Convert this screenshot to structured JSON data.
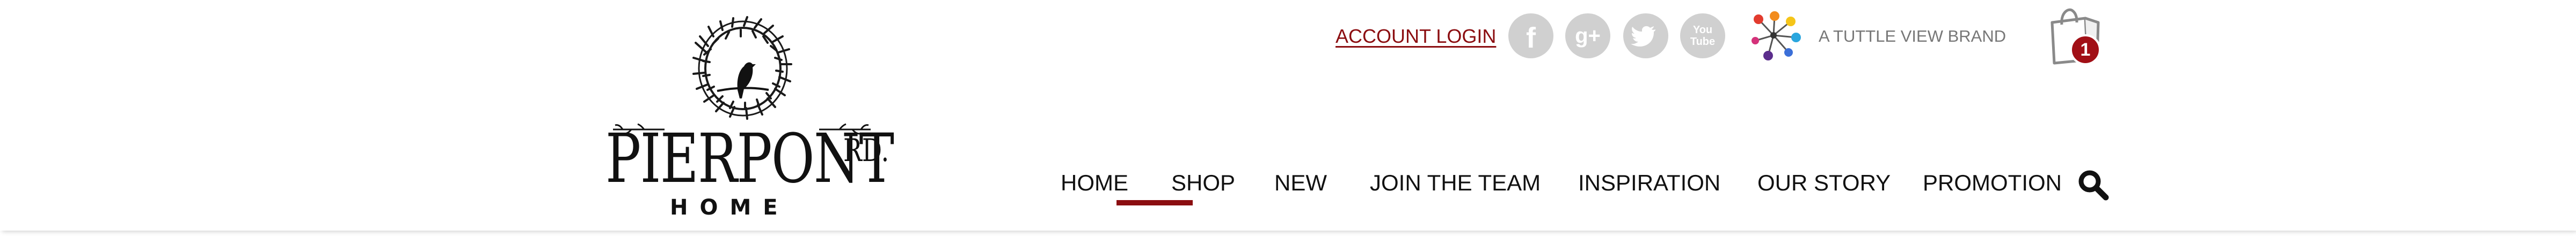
{
  "logo": {
    "main_text": "PIERPONT",
    "suffix_text": "RD.",
    "sub_text": "HOME"
  },
  "utility_bar": {
    "account_login": "ACCOUNT LOGIN",
    "social_links": [
      {
        "icon": "facebook-icon",
        "glyph": "f"
      },
      {
        "icon": "google-plus-icon",
        "glyph": "g+"
      },
      {
        "icon": "twitter-icon",
        "glyph": ""
      },
      {
        "icon": "youtube-icon",
        "glyph": "You Tube"
      }
    ],
    "brand_label": "A TUTTLE VIEW BRAND",
    "cart_count": "1"
  },
  "nav": {
    "items": [
      "HOME",
      "SHOP",
      "NEW",
      "JOIN THE TEAM",
      "INSPIRATION",
      "OUR STORY",
      "PROMOTION"
    ],
    "active_index": 1,
    "search_icon": "search-icon"
  },
  "colors": {
    "accent": "#8b0d10",
    "badge": "#a10f16",
    "social_gray": "#d0d0d0",
    "brand_label_gray": "#777777",
    "text": "#111111"
  }
}
